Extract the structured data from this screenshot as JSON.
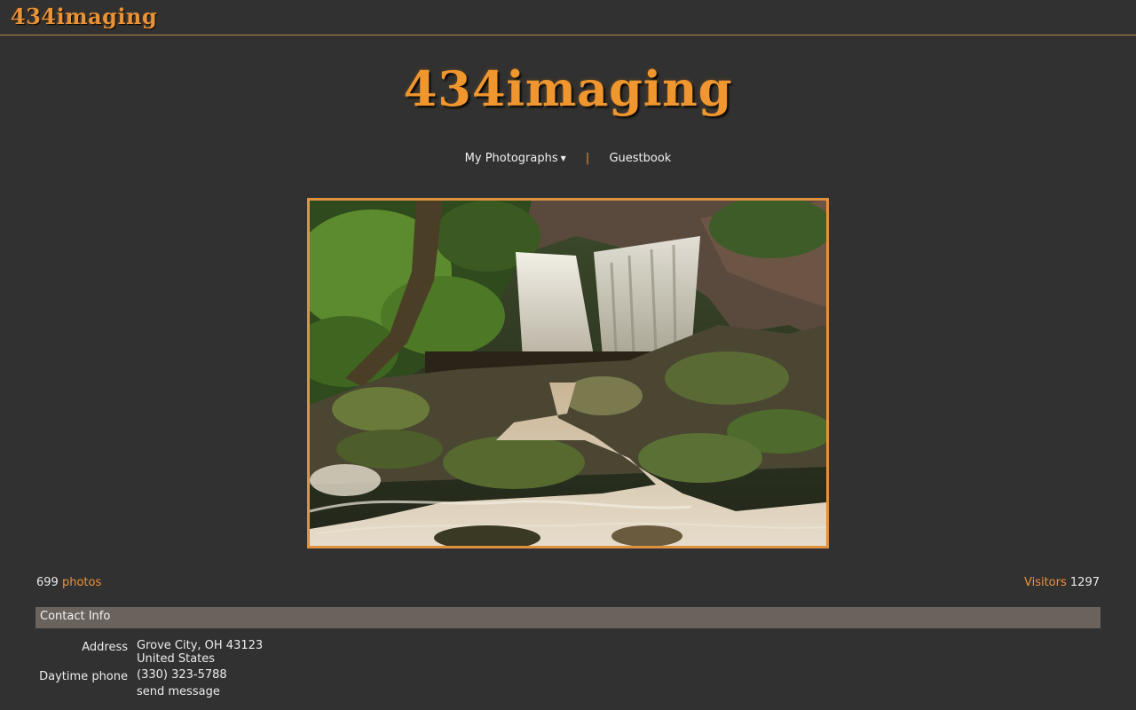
{
  "header": {
    "site_name": "434imaging"
  },
  "logo": {
    "text": "434imaging"
  },
  "nav": {
    "items": [
      {
        "label": "My Photographs",
        "has_dropdown": true
      },
      {
        "label": "Guestbook"
      }
    ],
    "separator": "|"
  },
  "stats": {
    "photo_count": "699",
    "photos_label": "photos",
    "visitors_label": "Visitors",
    "visitors_count": "1297"
  },
  "contact": {
    "heading": "Contact Info",
    "address_label": "Address",
    "address_line1": "Grove City, OH 43123",
    "address_line2": "United States",
    "phone_label": "Daytime phone",
    "phone": "(330) 323-5788",
    "send_message": "send message"
  },
  "colors": {
    "background": "#313131",
    "accent": "#e8933a",
    "contact_bar": "#6a625d"
  },
  "icons": {
    "dropdown": "caret-down-icon"
  }
}
